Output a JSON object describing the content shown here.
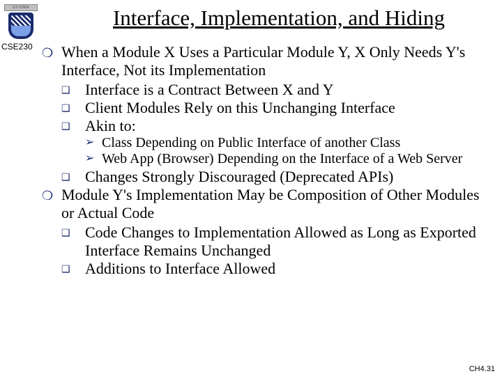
{
  "logo_text": "UCONN",
  "course": "CSE230",
  "title": "Interface, Implementation, and Hiding",
  "p1": "When a Module X Uses a Particular Module Y, X Only Needs Y's Interface, Not its Implementation",
  "p1_q1": "Interface is a Contract Between X and Y",
  "p1_q2": "Client Modules Rely on this Unchanging Interface",
  "p1_q3": "Akin to:",
  "p1_q3_a1": "Class Depending on Public Interface of another Class",
  "p1_q3_a2": "Web App (Browser) Depending on the Interface of a Web Server",
  "p1_q4": "Changes Strongly Discouraged (Deprecated APIs)",
  "p2": "Module Y's Implementation May be Composition of Other Modules or Actual Code",
  "p2_q1": "Code Changes to Implementation Allowed as Long as Exported Interface Remains Unchanged",
  "p2_q2": "Additions to Interface Allowed",
  "footer": "CH4.31"
}
